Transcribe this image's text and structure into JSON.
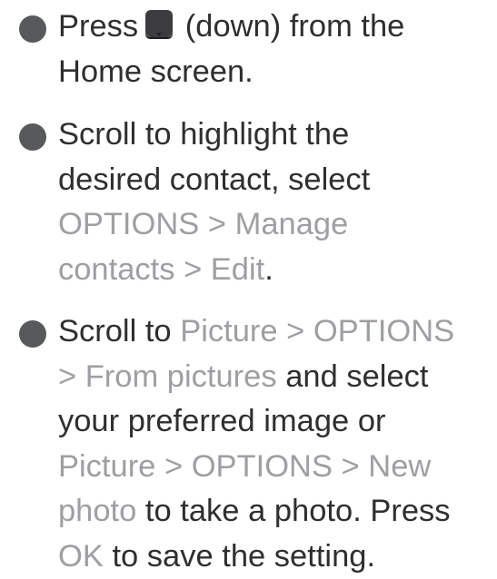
{
  "colors": {
    "body_text": "#2f2f31",
    "highlight_text": "#9d9fa2",
    "bullet": "#58595b",
    "key_icon": "#3c3c3e"
  },
  "steps": [
    {
      "lines": [
        [
          {
            "text": "Press",
            "style": "normal"
          },
          {
            "icon": "down-key-icon"
          },
          {
            "text": " (down) from the",
            "style": "normal"
          }
        ],
        [
          {
            "text": "Home screen.",
            "style": "normal"
          }
        ]
      ]
    },
    {
      "lines": [
        [
          {
            "text": "Scroll to highlight the",
            "style": "normal"
          }
        ],
        [
          {
            "text": "desired contact, select",
            "style": "normal"
          }
        ],
        [
          {
            "text": "OPTIONS > Manage",
            "style": "highlight"
          }
        ],
        [
          {
            "text": "contacts > Edit",
            "style": "highlight"
          },
          {
            "text": ".",
            "style": "normal"
          }
        ]
      ]
    },
    {
      "lines": [
        [
          {
            "text": "Scroll to ",
            "style": "normal"
          },
          {
            "text": "Picture > OPTIONS",
            "style": "highlight"
          }
        ],
        [
          {
            "text": "> From pictures",
            "style": "highlight"
          },
          {
            "text": " and select",
            "style": "normal"
          }
        ],
        [
          {
            "text": "your preferred image or",
            "style": "normal"
          }
        ],
        [
          {
            "text": "Picture > OPTIONS > New",
            "style": "highlight"
          }
        ],
        [
          {
            "text": "photo",
            "style": "highlight"
          },
          {
            "text": " to take a photo. Press",
            "style": "normal"
          }
        ],
        [
          {
            "text": "OK",
            "style": "highlight"
          },
          {
            "text": " to save the setting.",
            "style": "normal"
          }
        ]
      ]
    }
  ]
}
